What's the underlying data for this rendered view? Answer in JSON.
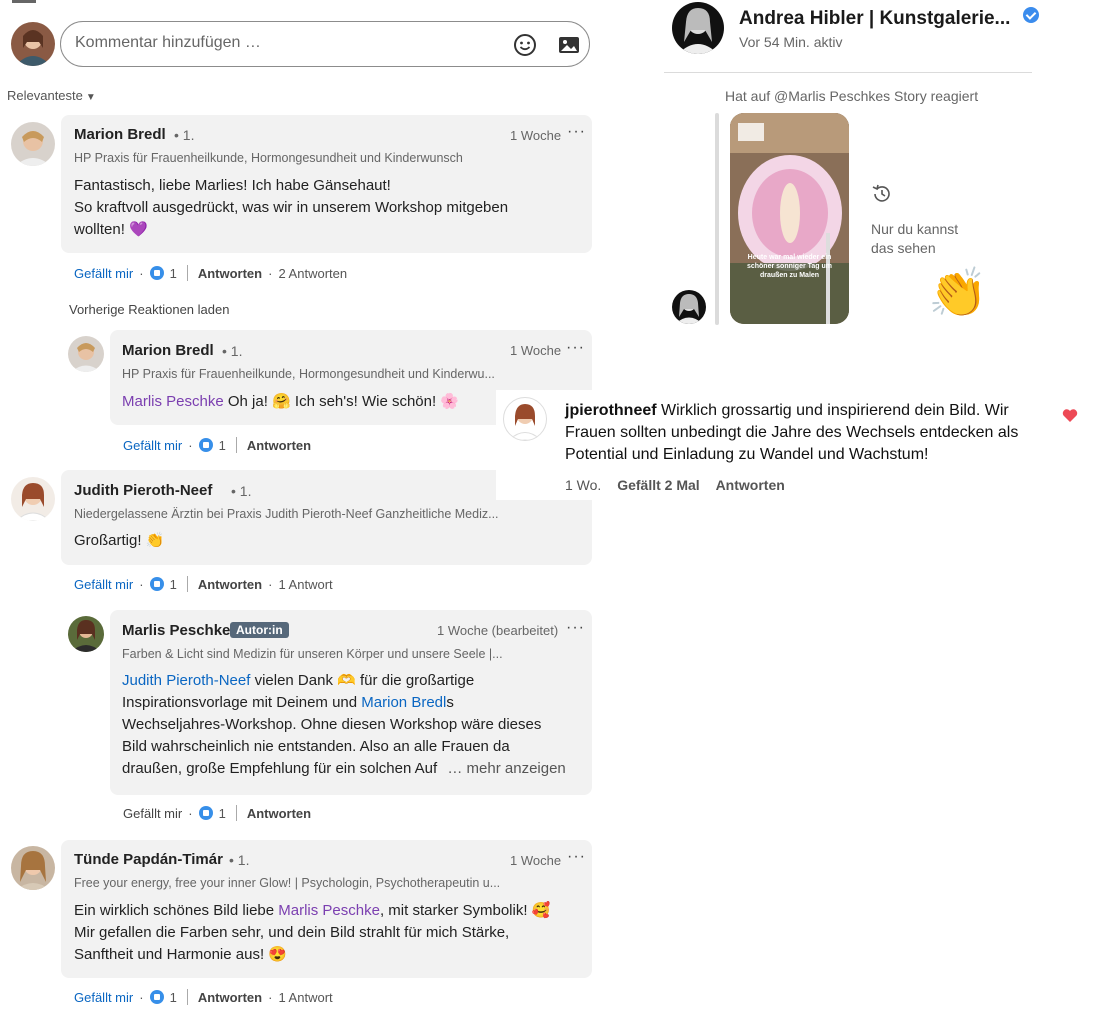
{
  "composer": {
    "placeholder": "Kommentar hinzufügen …"
  },
  "sort_label": "Relevanteste",
  "load_previous": "Vorherige Reaktionen laden",
  "comments": [
    {
      "name": "Marion Bredl",
      "degree": "• 1.",
      "time": "1 Woche",
      "headline": "HP Praxis für Frauenheilkunde, Hormongesundheit und Kinderwunsch",
      "text_line1": "Fantastisch, liebe Marlies! Ich habe Gänsehaut!",
      "text_line2": "So kraftvoll ausgedrückt, was wir in unserem Workshop mitgeben",
      "text_line3": "wollten! 💜",
      "like_label": "Gefällt mir",
      "like_count": "1",
      "reply_label": "Antworten",
      "replies": "2 Antworten"
    },
    {
      "name": "Marion Bredl",
      "degree": "• 1.",
      "time": "1 Woche",
      "headline": "HP Praxis für Frauenheilkunde, Hormongesundheit und Kinderwu...",
      "mention": "Marlis Peschke",
      "text": "Oh ja! 🤗 Ich seh's! Wie schön! 🌸",
      "like_label": "Gefällt mir",
      "like_count": "1",
      "reply_label": "Antworten"
    },
    {
      "name": "Judith Pieroth-Neef",
      "degree": "• 1.",
      "time": "",
      "headline": "Niedergelassene Ärztin bei Praxis Judith Pieroth-Neef Ganzheitliche Mediz...",
      "text": "Großartig! 👏",
      "like_label": "Gefällt mir",
      "like_count": "1",
      "reply_label": "Antworten",
      "replies": "1 Antwort"
    },
    {
      "name": "Marlis Peschke",
      "badge": "Autor:in",
      "time": "1 Woche (bearbeitet)",
      "headline": "Farben & Licht sind Medizin für unseren Körper und unsere Seele |...",
      "mention1": "Judith Pieroth-Neef",
      "t1": " vielen Dank 🫶 für die großartige",
      "t2": "Inspirationsvorlage mit Deinem und ",
      "mention2": "Marion Bredl",
      "t3": "s",
      "t4": "Wechseljahres-Workshop. Ohne diesen Workshop wäre dieses",
      "t5": "Bild wahrscheinlich nie entstanden. Also an alle Frauen da",
      "t6": "draußen, große Empfehlung für ein solchen Auf",
      "more": "… mehr anzeigen",
      "like_label": "Gefällt mir",
      "like_count": "1",
      "reply_label": "Antworten"
    },
    {
      "name": "Tünde Papdán-Timár",
      "degree": "• 1.",
      "time": "1 Woche",
      "headline": "Free your energy, free your inner Glow! | Psychologin, Psychotherapeutin u...",
      "t1": "Ein wirklich schönes Bild liebe ",
      "mention": "Marlis Peschke",
      "t2": ", mit starker Symbolik! 🥰",
      "t3": "Mir gefallen die Farben sehr, und dein Bild strahlt für mich Stärke,",
      "t4": "Sanftheit und Harmonie aus! 😍",
      "like_label": "Gefällt mir",
      "like_count": "1",
      "reply_label": "Antworten",
      "replies": "1 Antwort"
    }
  ],
  "chat": {
    "name": "Andrea Hibler | Kunstgalerie...",
    "status": "Vor 54 Min. aktiv",
    "reacted": "Hat auf @Marlis Peschkes Story reagiert",
    "only_you_line1": "Nur du kannst",
    "only_you_line2": "das sehen",
    "story_text": "Heute war mal wieder ein schöner sonniger Tag um draußen zu Malen",
    "reaction": "👏"
  },
  "ig_comment": {
    "user": "jpierothneef",
    "line1": "Wirklich grossartig und inspirierend dein Bild. Wir",
    "line2": "Frauen sollten unbedingt die Jahre des Wechsels entdecken als",
    "line3": "Potential und Einladung zu Wandel und Wachstum!",
    "time": "1 Wo.",
    "likes": "Gefällt 2 Mal",
    "reply": "Antworten"
  },
  "colors": {
    "accent": "#0a66c2",
    "mention": "#7b3fb0",
    "card_bg": "#f2f2f2",
    "heart": "#ed4956"
  }
}
